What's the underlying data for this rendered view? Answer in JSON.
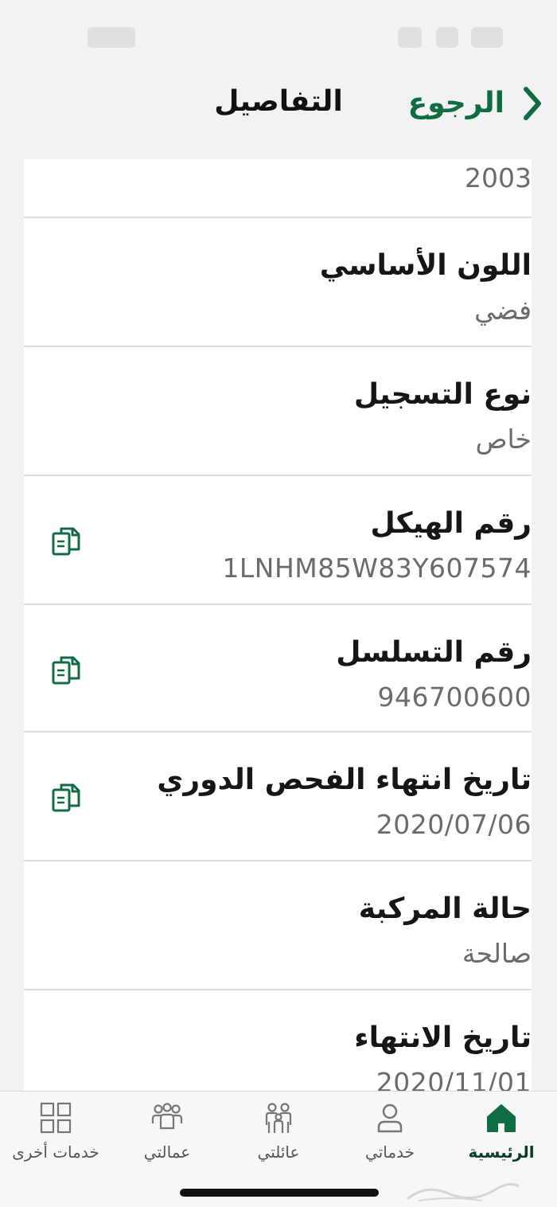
{
  "nav": {
    "title": "التفاصيل",
    "back_label": "الرجوع"
  },
  "first_value": "2003",
  "rows": [
    {
      "label": "اللون الأساسي",
      "value": "فضي",
      "copyable": false
    },
    {
      "label": "نوع التسجيل",
      "value": "خاص",
      "copyable": false
    },
    {
      "label": "رقم الهيكل",
      "value": "1LNHM85W83Y607574",
      "copyable": true
    },
    {
      "label": "رقم التسلسل",
      "value": "946700600",
      "copyable": true
    },
    {
      "label": "تاريخ انتهاء الفحص الدوري",
      "value": "2020/07/06",
      "copyable": true
    },
    {
      "label": "حالة المركبة",
      "value": "صالحة",
      "copyable": false
    },
    {
      "label": "تاريخ الانتهاء",
      "value": "2020/11/01",
      "copyable": false
    }
  ],
  "tabs": [
    {
      "label": "الرئيسية",
      "icon": "home-icon",
      "active": true
    },
    {
      "label": "خدماتي",
      "icon": "person-icon",
      "active": false
    },
    {
      "label": "عائلتي",
      "icon": "family-icon",
      "active": false
    },
    {
      "label": "عمالتي",
      "icon": "workers-icon",
      "active": false
    },
    {
      "label": "خدمات أخرى",
      "icon": "grid-icon",
      "active": false
    }
  ],
  "colors": {
    "accent": "#106c43",
    "active_tab": "#0b3d25",
    "label": "#161616",
    "value": "#6b6b6b",
    "background": "#f2f2f2"
  }
}
